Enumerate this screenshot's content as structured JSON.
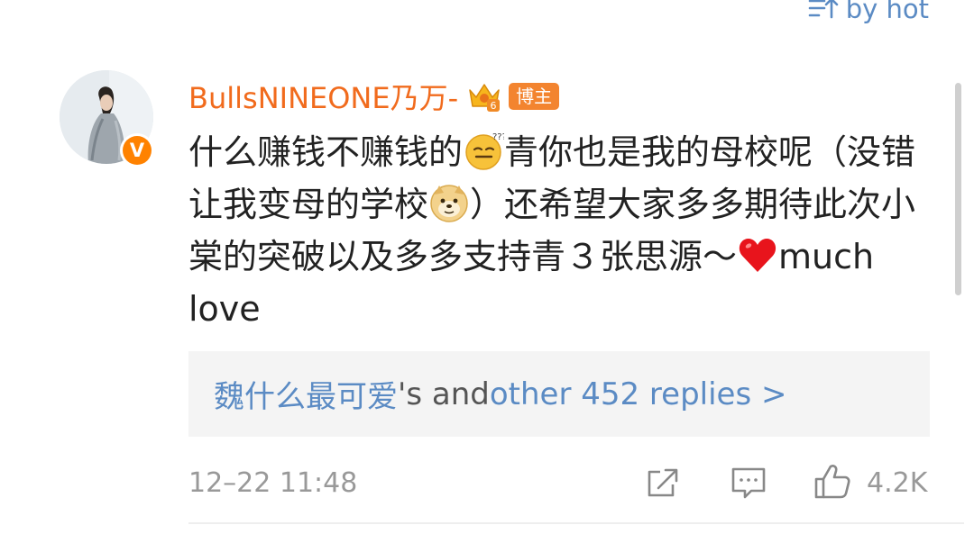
{
  "sort": {
    "label": "by hot",
    "icon": "sort-icon"
  },
  "comment": {
    "avatar_icon": "avatar",
    "verified_badge": "V",
    "username": "BullsNINEONE乃万-",
    "crown_icon": "crown-6-icon",
    "tag": "博主",
    "text": {
      "part1": "什么赚钱不赚钱的",
      "emoji1": "dizzy-smile-emoji",
      "part2": "青你也是我的母校呢（没错让我变母的学校",
      "emoji2": "doge-emoji",
      "part3": "）还希望大家多多期待此次小棠的突破以及多多支持青３张思源～",
      "emoji3": "red-heart-emoji",
      "part4": "much love"
    },
    "replies": {
      "user": "魏什么最可爱",
      "connector": "'s and ",
      "count_text": "other 452 replies >"
    },
    "timestamp": "12–22 11:48",
    "like_count": "4.2K",
    "icons": {
      "share": "share-icon",
      "comment": "comment-icon",
      "like": "thumbs-up-icon"
    }
  },
  "colors": {
    "username": "#f16b1d",
    "link": "#5b8bc4",
    "badge": "#ff8200",
    "muted": "#999999",
    "text": "#222222"
  }
}
